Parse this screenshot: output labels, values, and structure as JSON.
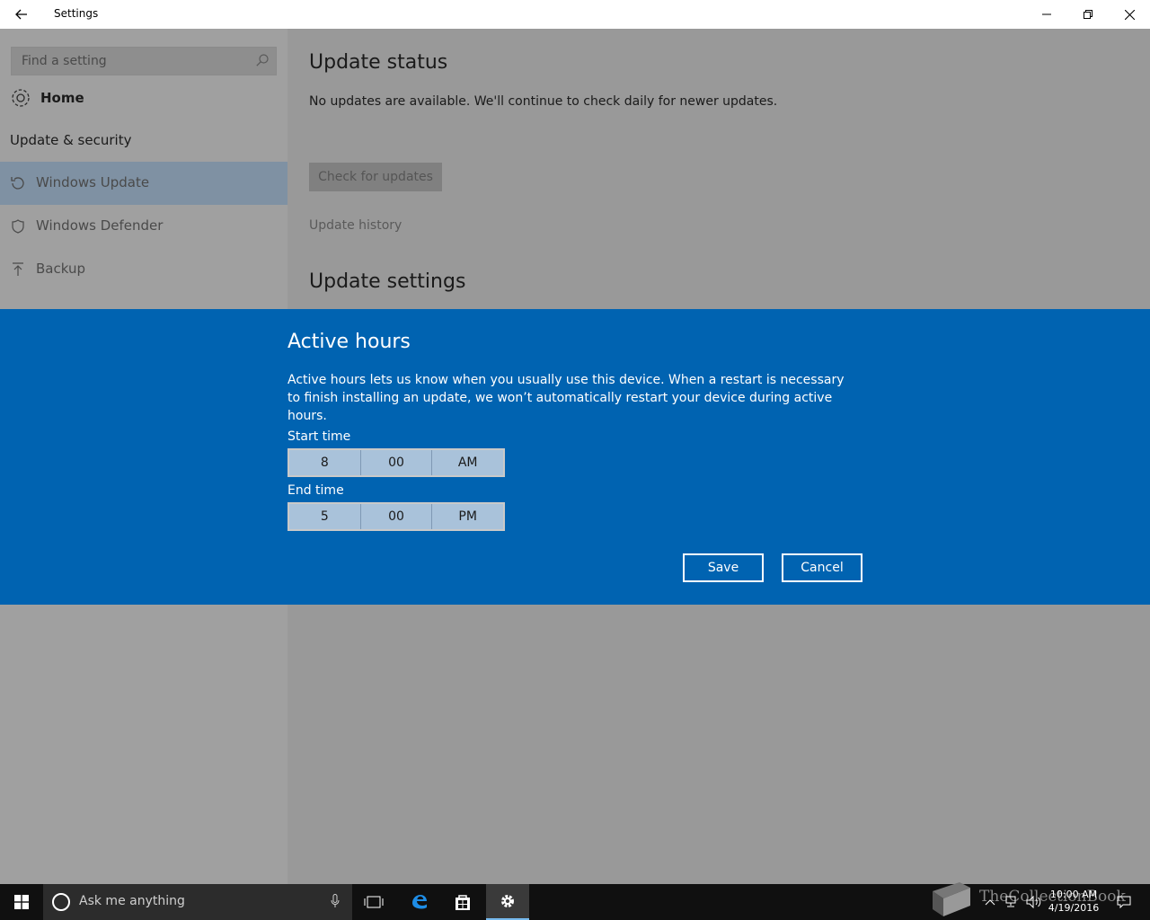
{
  "window": {
    "title": "Settings"
  },
  "sidebar": {
    "search_placeholder": "Find a setting",
    "home_label": "Home",
    "section_title": "Update & security",
    "items": [
      {
        "label": "Windows Update",
        "icon": "refresh-icon",
        "selected": true
      },
      {
        "label": "Windows Defender",
        "icon": "shield-icon",
        "selected": false
      },
      {
        "label": "Backup",
        "icon": "upload-arrow-icon",
        "selected": false
      }
    ]
  },
  "main": {
    "update_status_title": "Update status",
    "status_text": "No updates are available. We'll continue to check daily for newer updates.",
    "check_button": "Check for updates",
    "history_link": "Update history",
    "update_settings_title": "Update settings"
  },
  "dialog": {
    "title": "Active hours",
    "description": "Active hours lets us know when you usually use this device. When a restart is necessary to finish installing an update, we won’t automatically restart your device during active hours.",
    "start_label": "Start time",
    "start": {
      "hour": "8",
      "minute": "00",
      "period": "AM"
    },
    "end_label": "End time",
    "end": {
      "hour": "5",
      "minute": "00",
      "period": "PM"
    },
    "save_label": "Save",
    "cancel_label": "Cancel",
    "accent_color": "#0063b1"
  },
  "taskbar": {
    "search_placeholder": "Ask me anything",
    "time": "10:00 AM",
    "date": "4/19/2016",
    "watermark": "TheCollectionBook"
  }
}
